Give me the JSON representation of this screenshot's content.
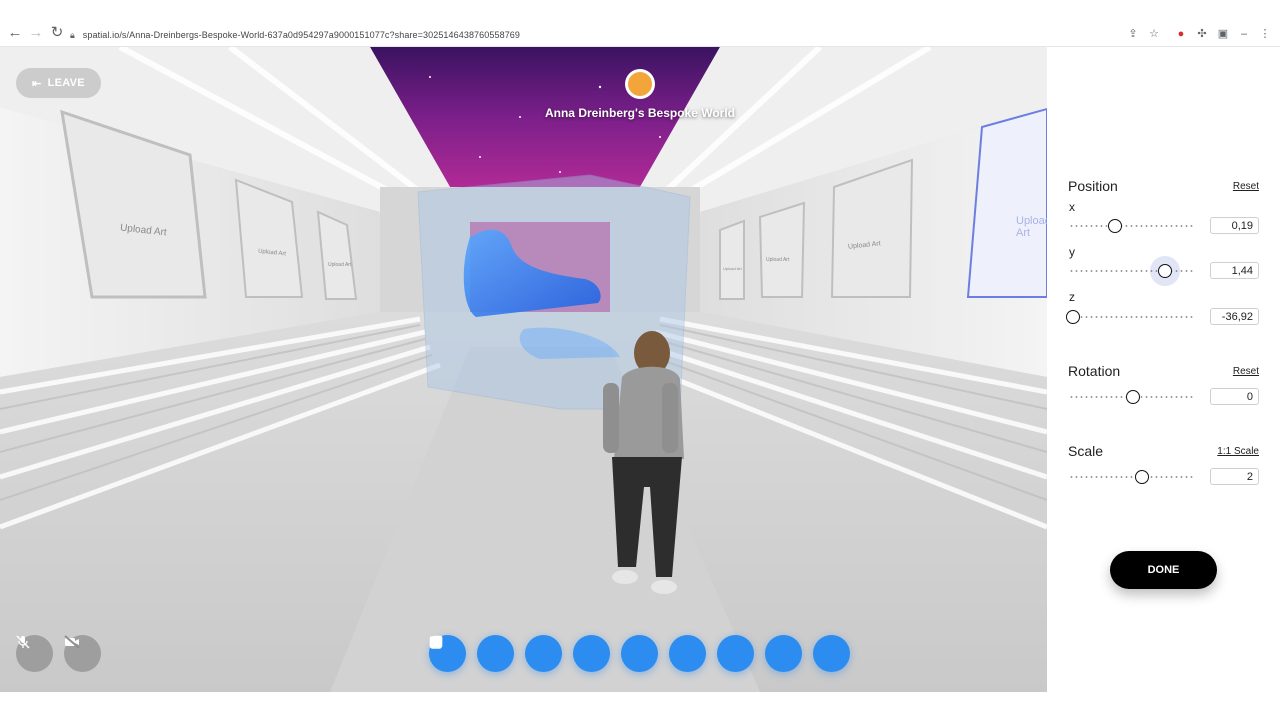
{
  "browser": {
    "url": "spatial.io/s/Anna-Dreinbergs-Bespoke-World-637a0d954297a9000151077c?share=3025146438760558769",
    "icons": [
      "back-icon",
      "forward-icon",
      "reload-icon",
      "lock-icon",
      "share-icon",
      "star-icon",
      "extension-icons",
      "menu-icon"
    ]
  },
  "scene": {
    "leave_label": "LEAVE",
    "world_title": "Anna Dreinberg's Bespoke World",
    "frame_labels": [
      "Upload Art",
      "Upload Art",
      "Upload Art",
      "Upload Art",
      "Upload Art",
      "Upload Art",
      "Upload Art",
      "Upload Art"
    ],
    "toolbar_icons": [
      "download-icon",
      "lock-icon",
      "rotate-icon",
      "edit-icon",
      "info-icon",
      "duplicate-icon",
      "image-icon",
      "frame-icon",
      "trash-icon"
    ],
    "bottom_left_icons": [
      "mic-off-icon",
      "camera-off-icon"
    ]
  },
  "panel": {
    "position": {
      "title": "Position",
      "reset_label": "Reset",
      "x": {
        "label": "x",
        "value": "0,19",
        "slider_fraction": 0.37
      },
      "y": {
        "label": "y",
        "value": "1,44",
        "slider_fraction": 0.77
      },
      "z": {
        "label": "z",
        "value": "-36,92",
        "slider_fraction": 0.03
      }
    },
    "rotation": {
      "title": "Rotation",
      "reset_label": "Reset",
      "value": "0",
      "slider_fraction": 0.51
    },
    "scale": {
      "title": "Scale",
      "link_label": "1:1 Scale",
      "value": "2",
      "slider_fraction": 0.58
    },
    "done_label": "DONE"
  },
  "colors": {
    "accent_blue": "#2d8cf0",
    "panel_bg": "#ffffff",
    "done_bg": "#000000"
  }
}
